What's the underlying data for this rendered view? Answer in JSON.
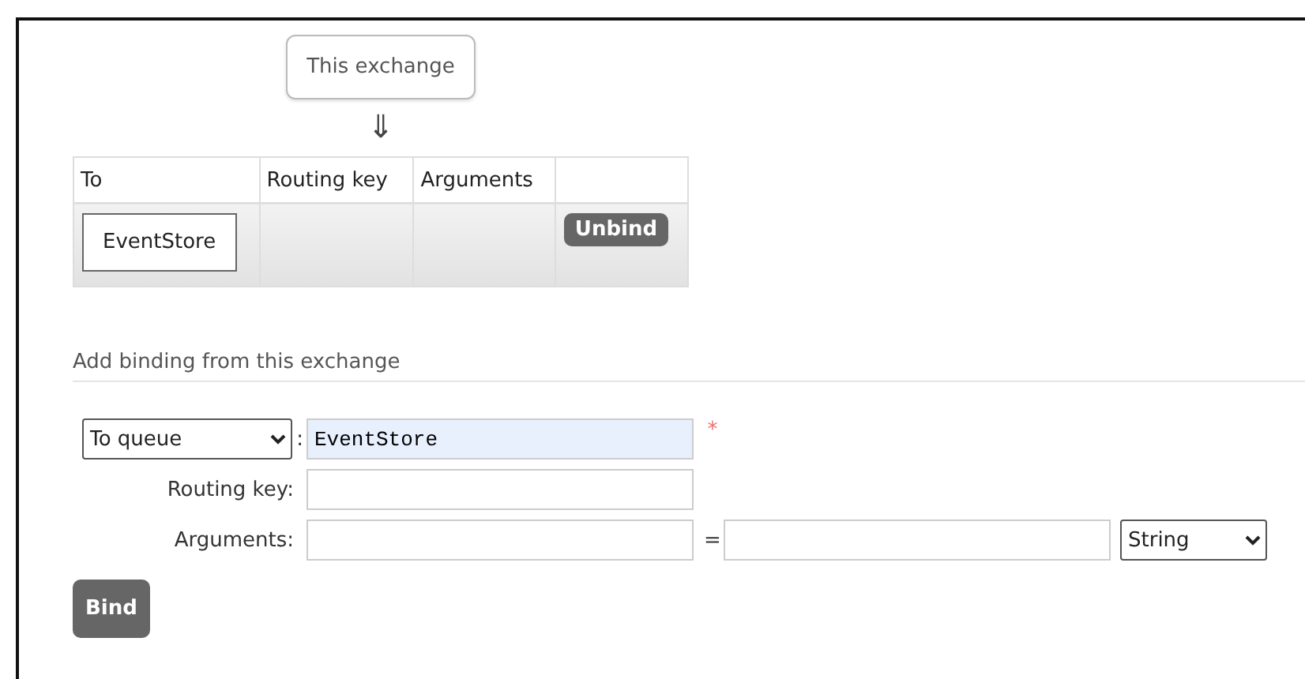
{
  "source_node": {
    "label": "This exchange",
    "arrow": "⇓"
  },
  "bindings_table": {
    "columns": [
      "To",
      "Routing key",
      "Arguments",
      ""
    ],
    "rows": [
      {
        "to": "EventStore",
        "routing_key": "",
        "arguments": "",
        "action": "Unbind"
      }
    ]
  },
  "add_binding": {
    "heading": "Add binding from this exchange",
    "destination_type": "To queue",
    "destination_separator": ":",
    "destination_value": "EventStore",
    "required_mark": "*",
    "routing_key_label": "Routing key:",
    "arguments_label": "Arguments:",
    "equals": "=",
    "argument_type": "String",
    "submit": "Bind"
  }
}
